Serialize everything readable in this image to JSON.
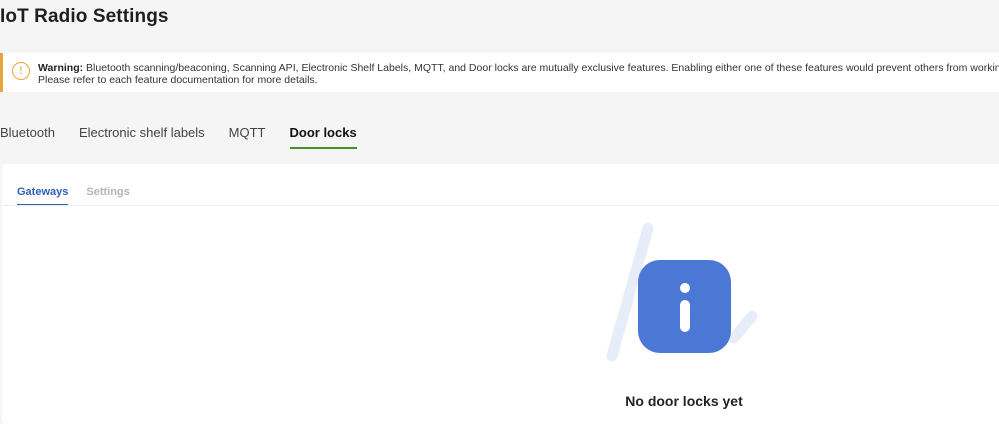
{
  "page": {
    "title": "IoT Radio Settings"
  },
  "warning": {
    "icon": "warning-exclamation-icon",
    "label": "Warning:",
    "message": "Bluetooth scanning/beaconing, Scanning API, Electronic Shelf Labels, MQTT, and Door locks are mutually exclusive features. Enabling either one of these features would prevent others from working. Please refer to each feature documentation for more details.",
    "accent_color": "#e8a43c"
  },
  "tabs": [
    {
      "label": "Bluetooth",
      "active": false
    },
    {
      "label": "Electronic shelf labels",
      "active": false
    },
    {
      "label": "MQTT",
      "active": false
    },
    {
      "label": "Door locks",
      "active": true
    }
  ],
  "subtabs": [
    {
      "label": "Gateways",
      "active": true
    },
    {
      "label": "Settings",
      "active": false
    }
  ],
  "empty_state": {
    "icon": "info-icon",
    "title": "No door locks yet",
    "icon_color": "#4a78d4"
  },
  "colors": {
    "active_tab_underline": "#4a8d2c",
    "active_subtab": "#2f5fb8"
  }
}
